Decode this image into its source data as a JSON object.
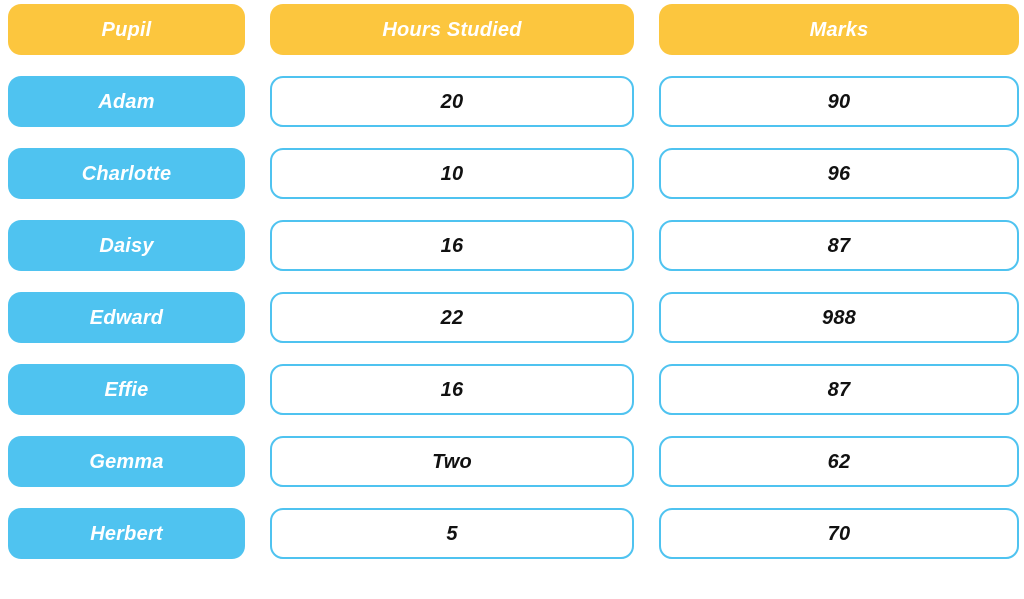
{
  "table": {
    "columns": [
      {
        "key": "pupil",
        "label": "Pupil",
        "style": "header-yellow"
      },
      {
        "key": "hours",
        "label": "Hours Studied",
        "style": "header-yellow"
      },
      {
        "key": "marks",
        "label": "Marks",
        "style": "header-yellow"
      }
    ],
    "rows": [
      {
        "pupil": "Adam",
        "hours": "20",
        "marks": "90"
      },
      {
        "pupil": "Charlotte",
        "hours": "10",
        "marks": "96"
      },
      {
        "pupil": "Daisy",
        "hours": "16",
        "marks": "87"
      },
      {
        "pupil": "Edward",
        "hours": "22",
        "marks": "988"
      },
      {
        "pupil": "Effie",
        "hours": "16",
        "marks": "87"
      },
      {
        "pupil": "Gemma",
        "hours": "Two",
        "marks": "62"
      },
      {
        "pupil": "Herbert",
        "hours": "5",
        "marks": "70"
      }
    ]
  },
  "colors": {
    "header_fill": "#fcc63e",
    "name_fill": "#4fc3f0",
    "value_border": "#4fc3f0",
    "value_fill": "#ffffff",
    "header_text": "#ffffff",
    "name_text": "#ffffff",
    "value_text": "#111111",
    "background": "#ffffff"
  },
  "chart_data": {
    "type": "table",
    "title": "",
    "columns": [
      "Pupil",
      "Hours Studied",
      "Marks"
    ],
    "rows": [
      [
        "Adam",
        "20",
        "90"
      ],
      [
        "Charlotte",
        "10",
        "96"
      ],
      [
        "Daisy",
        "16",
        "87"
      ],
      [
        "Edward",
        "22",
        "988"
      ],
      [
        "Effie",
        "16",
        "87"
      ],
      [
        "Gemma",
        "Two",
        "62"
      ],
      [
        "Herbert",
        "5",
        "70"
      ]
    ],
    "hours_studied": [
      20,
      10,
      16,
      22,
      16,
      null,
      5
    ],
    "marks": [
      90,
      96,
      87,
      988,
      87,
      62,
      70
    ],
    "non_numeric_entries": [
      {
        "row": "Gemma",
        "column": "Hours Studied",
        "value": "Two"
      }
    ],
    "outliers": [
      {
        "row": "Edward",
        "column": "Marks",
        "value": 988
      }
    ]
  }
}
